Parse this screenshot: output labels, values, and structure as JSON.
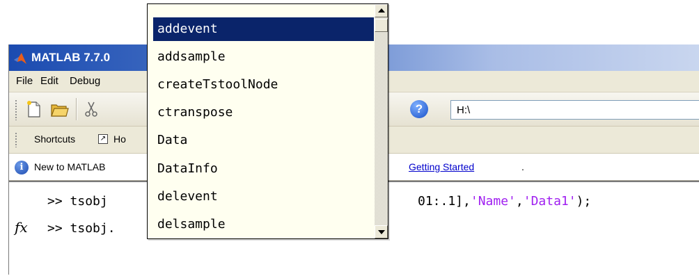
{
  "window": {
    "title": "MATLAB 7.7.0",
    "menu": [
      "File",
      "Edit",
      "Debug"
    ],
    "current_directory": "H:\\"
  },
  "shortcuts": {
    "label": "Shortcuts",
    "howto": "Ho"
  },
  "infobar": {
    "text": "New to MATLAB",
    "link": "Getting Started",
    "after": "."
  },
  "command_window": {
    "prompt": ">>",
    "line1_cmd": "tsobj",
    "line1_rest": "01:.1],",
    "line1_str1": "'Name'",
    "line1_comma": ",",
    "line1_str2": "'Data1'",
    "line1_end": ");",
    "line2_cmd": "tsobj.",
    "fx_symbol": "fx"
  },
  "autocomplete": {
    "items": [
      "addevent",
      "addsample",
      "createTstoolNode",
      "ctranspose",
      "Data",
      "DataInfo",
      "delevent",
      "delsample"
    ],
    "selected_index": 0
  },
  "colors": {
    "selection": "#0a246a",
    "popup_bg": "#fffff0",
    "string": "#a020f0",
    "titlebar": "#1b4bb0"
  }
}
